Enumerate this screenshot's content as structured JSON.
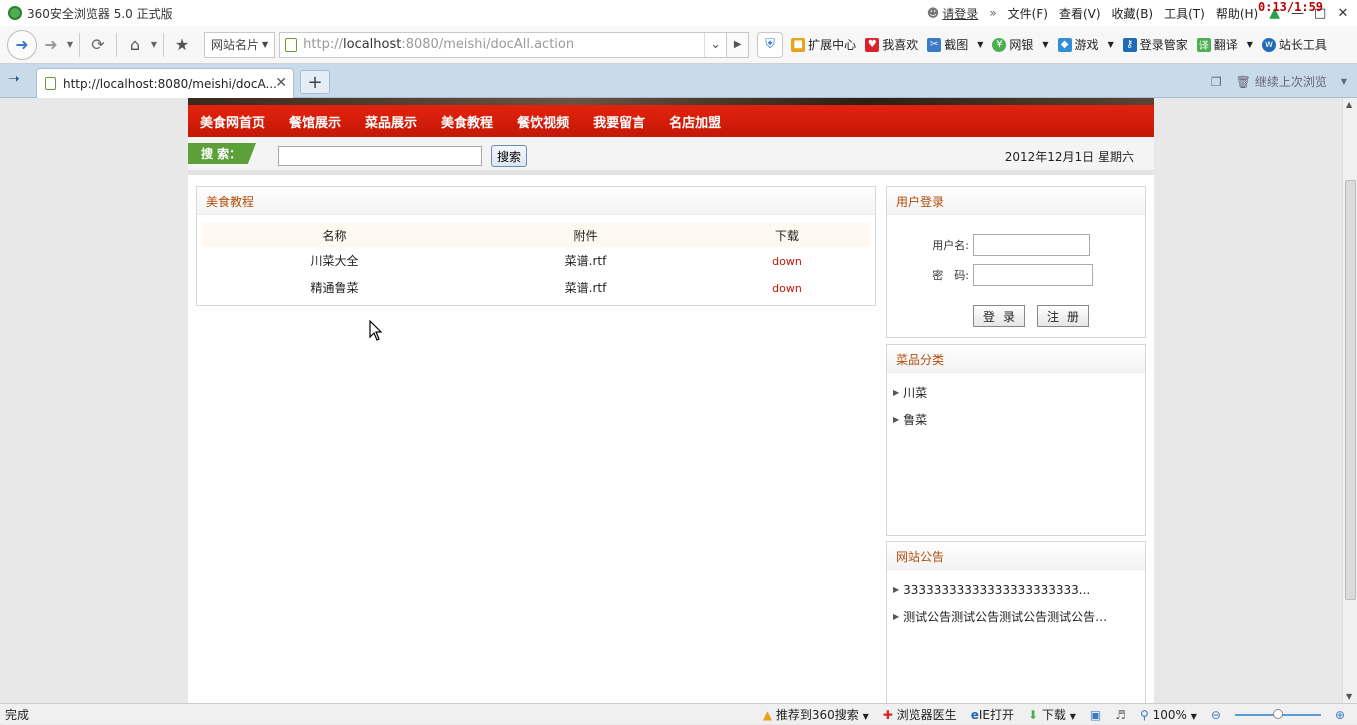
{
  "browser": {
    "title": "360安全浏览器 5.0 正式版",
    "login_link": "请登录",
    "menu": [
      "文件(F)",
      "查看(V)",
      "收藏(B)",
      "工具(T)",
      "帮助(H)"
    ],
    "clock": "0:13/1:59"
  },
  "toolbar": {
    "site_card": "网站名片",
    "url_prefix": "http://",
    "url_host": "localhost",
    "url_rest": ":8080/meishi/docAll.action",
    "tools": [
      "扩展中心",
      "我喜欢",
      "截图",
      "网银",
      "游戏",
      "登录管家",
      "翻译",
      "站长工具"
    ]
  },
  "tabs": {
    "active_tab": "http://localhost:8080/meishi/docA...",
    "right_action": "继续上次浏览"
  },
  "site": {
    "nav": [
      "美食网首页",
      "餐馆展示",
      "菜品展示",
      "美食教程",
      "餐饮视频",
      "我要留言",
      "名店加盟"
    ],
    "search_label": "搜 索：",
    "search_button": "搜索",
    "date": "2012年12月1日 星期六",
    "content": {
      "title": "美食教程",
      "headers": [
        "名称",
        "附件",
        "下载"
      ],
      "rows": [
        {
          "name": "川菜大全",
          "file": "菜谱.rtf",
          "action": "down"
        },
        {
          "name": "精通鲁菜",
          "file": "菜谱.rtf",
          "action": "down"
        }
      ]
    },
    "login": {
      "title": "用户登录",
      "username_label": "用户名:",
      "password_label": "密　码:",
      "login_button": "登录",
      "register_button": "注册"
    },
    "categories": {
      "title": "菜品分类",
      "items": [
        "川菜",
        "鲁菜"
      ]
    },
    "notices": {
      "title": "网站公告",
      "items": [
        "33333333333333333333333...",
        "测试公告测试公告测试公告测试公告…"
      ]
    }
  },
  "statusbar": {
    "left": "完成",
    "recommend": "推荐到360搜索",
    "doctor": "浏览器医生",
    "ie": "IE打开",
    "download": "下载",
    "zoom": "100%",
    "zoom_fraction": 0.5
  }
}
